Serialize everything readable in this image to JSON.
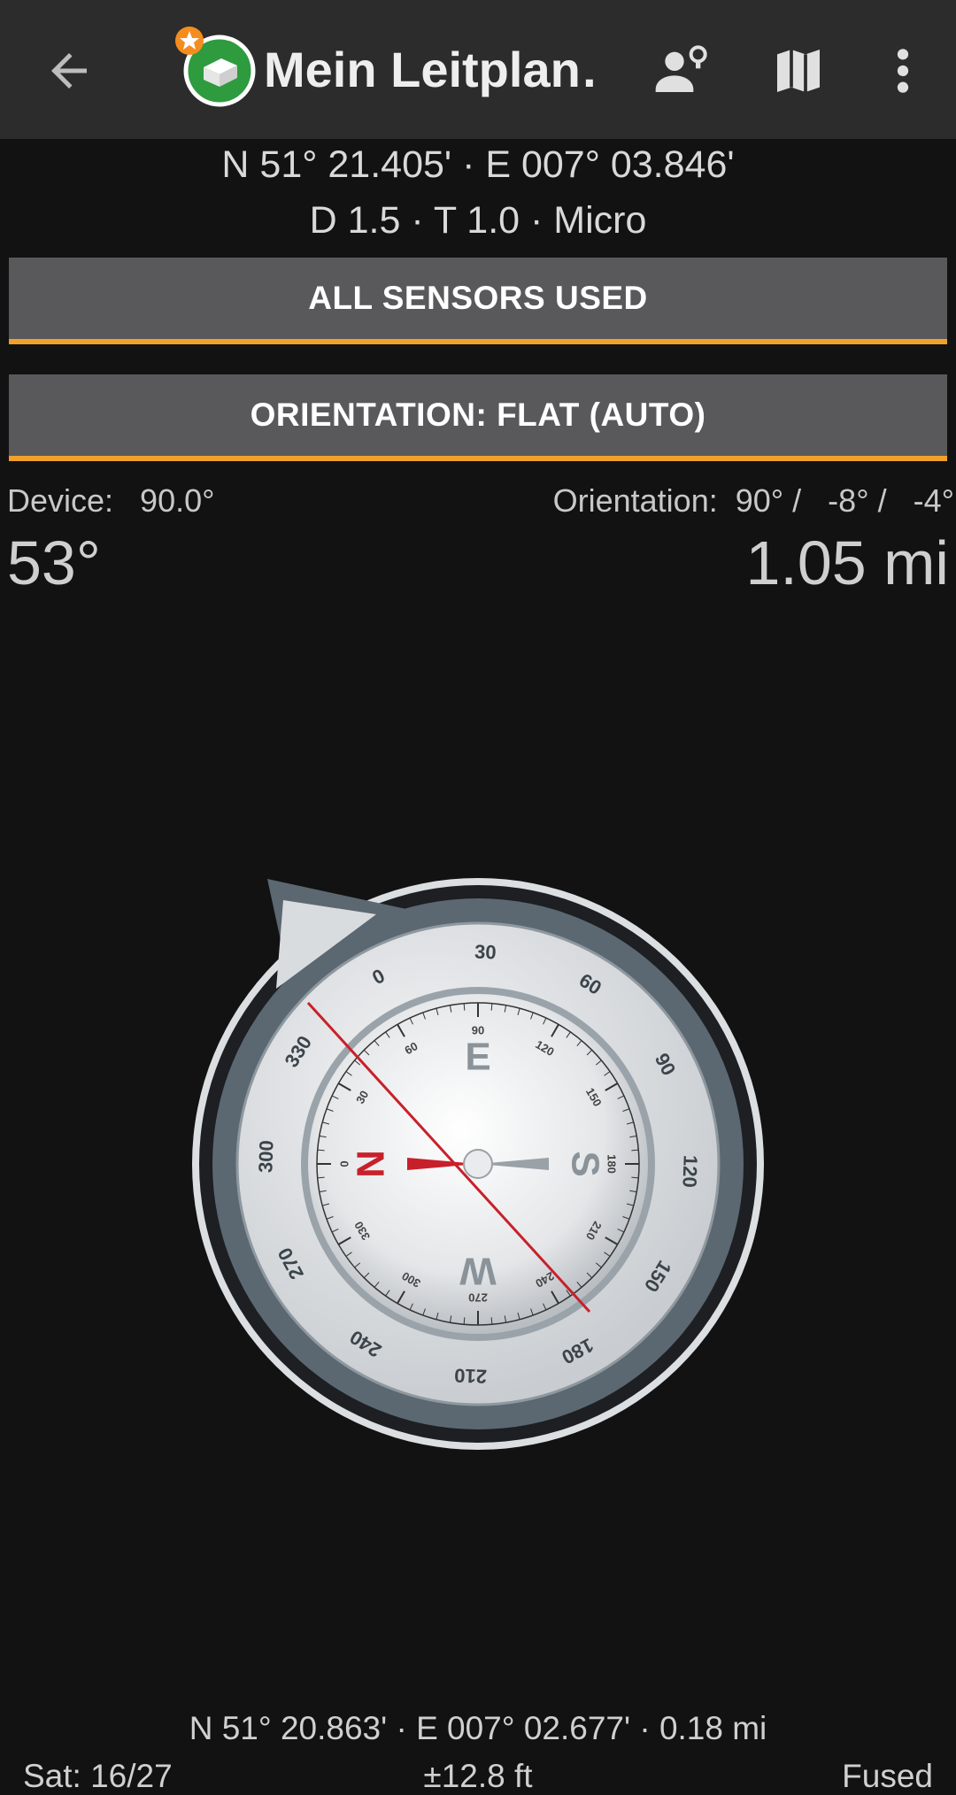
{
  "appbar": {
    "title": "Mein Leitplan…",
    "back_icon": "arrow-back-icon",
    "cache_icon": "traditional-cache-icon",
    "actions": [
      "user-lightbulb-icon",
      "map-icon",
      "more-vert-icon"
    ]
  },
  "target": {
    "coords": "N 51° 21.405' · E 007° 03.846'",
    "details": "D 1.5 · T 1.0 · Micro"
  },
  "buttons": {
    "sensors": "ALL SENSORS USED",
    "orientation": "ORIENTATION: FLAT (AUTO)"
  },
  "readings": {
    "device_label": "Device:   90.0°",
    "orientation_label": "Orientation:  90° /   -8° /   -4°",
    "bearing": "53°",
    "distance": "1.05 mi"
  },
  "compass": {
    "bezel_labels": [
      "0",
      "30",
      "60",
      "90",
      "120",
      "150",
      "180",
      "210",
      "240",
      "270",
      "300",
      "330"
    ],
    "dial_cardinals": [
      "N",
      "E",
      "S",
      "W"
    ],
    "dial_ticks": [
      "0",
      "30",
      "60",
      "90",
      "120",
      "150",
      "180",
      "210",
      "240",
      "270",
      "300",
      "330"
    ]
  },
  "footer": {
    "position": "N 51° 20.863' · E 007° 02.677' · 0.18 mi",
    "satellites": "Sat: 16/27",
    "accuracy": "±12.8 ft",
    "provider": "Fused"
  },
  "colors": {
    "accent": "#f1a02b",
    "appbar": "#2c2c2c",
    "background": "#121212",
    "button": "#59595b",
    "needle_red": "#c8202a"
  }
}
